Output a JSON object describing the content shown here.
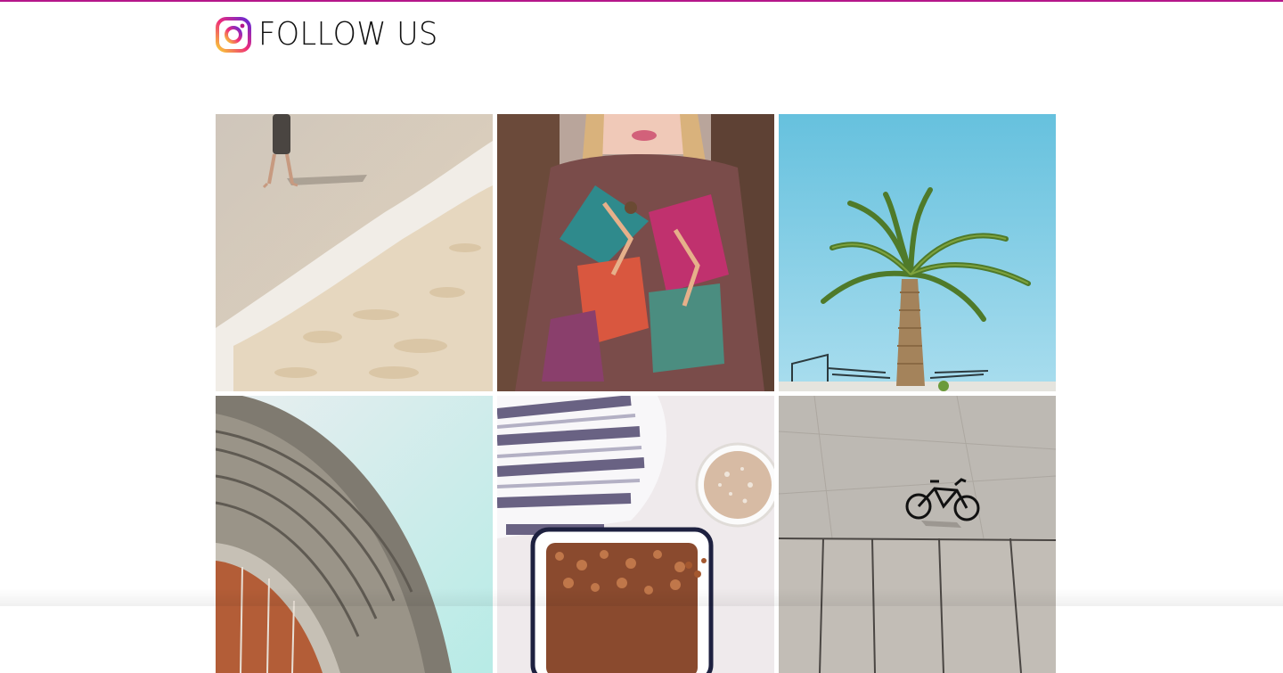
{
  "header": {
    "title": "FOLLOW US",
    "icon": "instagram-icon"
  },
  "colors": {
    "accent_bar": "#b5178a",
    "icon_gradient": [
      "#f9ce34",
      "#ee2a7b",
      "#6228d7"
    ]
  },
  "gallery": {
    "photos": [
      {
        "subject": "beach-walker-photo"
      },
      {
        "subject": "woman-in-poncho-photo"
      },
      {
        "subject": "palm-tree-photo"
      },
      {
        "subject": "architecture-curve-photo"
      },
      {
        "subject": "coffee-and-granola-photo"
      },
      {
        "subject": "bicycle-on-pavement-photo"
      }
    ]
  }
}
